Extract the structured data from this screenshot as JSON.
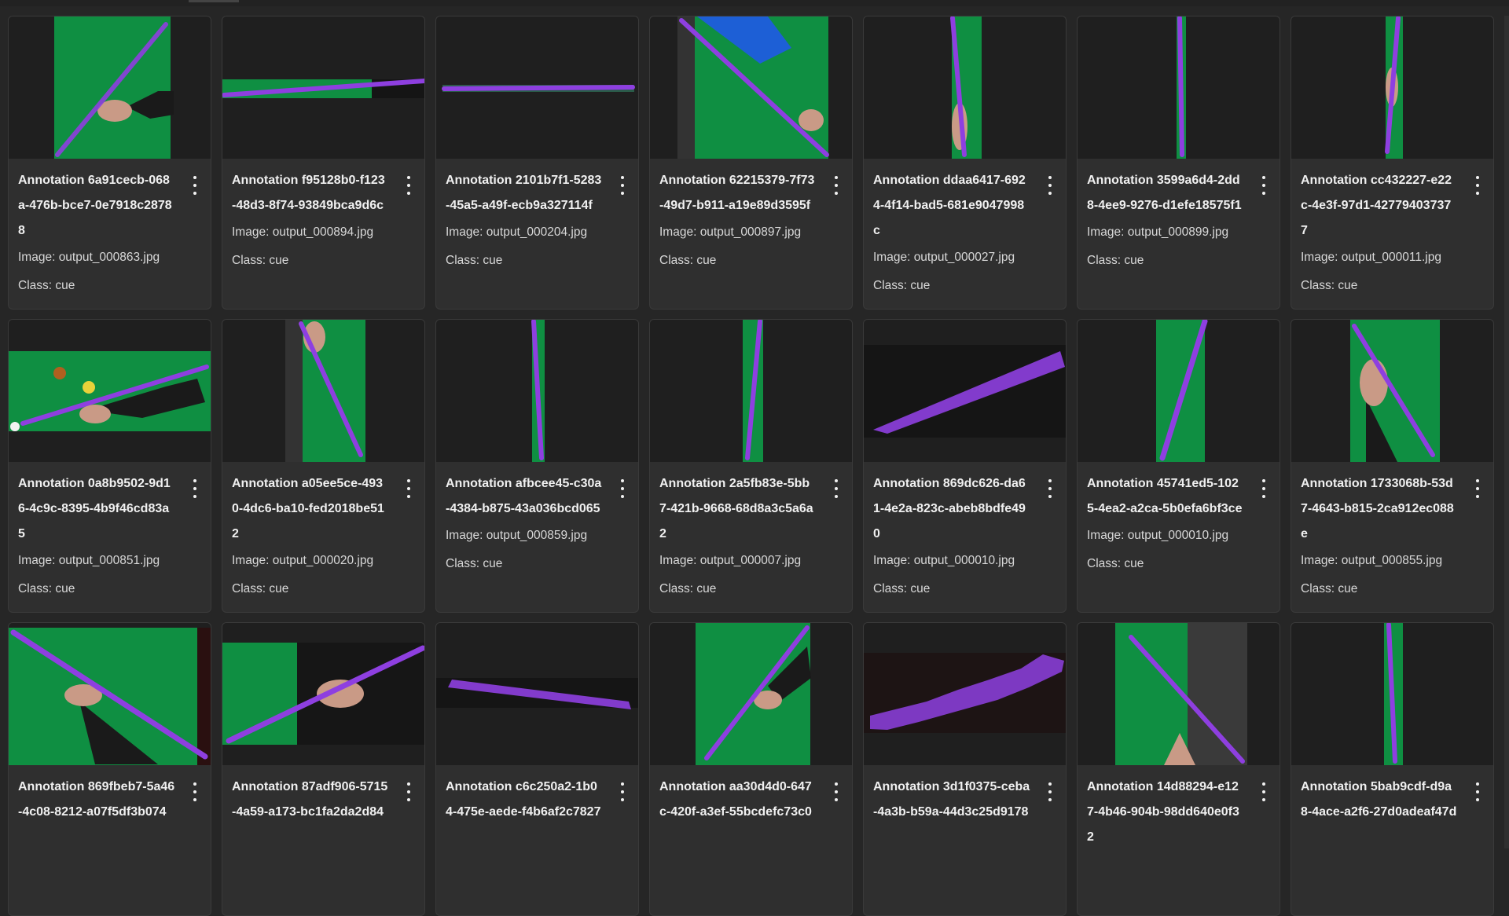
{
  "colors": {
    "background": "#262626",
    "card": "#2f2f2f",
    "felt": "#0f8f42",
    "mask": "#8e3fe0",
    "dark_frame": "#1f1f1f"
  },
  "cards": [
    {
      "title": "Annotation 6a91cecb-068a-476b-bce7-0e7918c28788",
      "image": "Image: output_000863.jpg",
      "class_label": "Class: cue"
    },
    {
      "title": "Annotation f95128b0-f123-48d3-8f74-93849bca9d6c",
      "image": "Image: output_000894.jpg",
      "class_label": "Class: cue"
    },
    {
      "title": "Annotation 2101b7f1-5283-45a5-a49f-ecb9a327114f",
      "image": "Image: output_000204.jpg",
      "class_label": "Class: cue"
    },
    {
      "title": "Annotation 62215379-7f73-49d7-b911-a19e89d3595f",
      "image": "Image: output_000897.jpg",
      "class_label": "Class: cue"
    },
    {
      "title": "Annotation ddaa6417-6924-4f14-bad5-681e9047998c",
      "image": "Image: output_000027.jpg",
      "class_label": "Class: cue"
    },
    {
      "title": "Annotation 3599a6d4-2dd8-4ee9-9276-d1efe18575f1",
      "image": "Image: output_000899.jpg",
      "class_label": "Class: cue"
    },
    {
      "title": "Annotation cc432227-e22c-4e3f-97d1-427794037377",
      "image": "Image: output_000011.jpg",
      "class_label": "Class: cue"
    },
    {
      "title": "Annotation 0a8b9502-9d16-4c9c-8395-4b9f46cd83a5",
      "image": "Image: output_000851.jpg",
      "class_label": "Class: cue"
    },
    {
      "title": "Annotation a05ee5ce-4930-4dc6-ba10-fed2018be512",
      "image": "Image: output_000020.jpg",
      "class_label": "Class: cue"
    },
    {
      "title": "Annotation afbcee45-c30a-4384-b875-43a036bcd065",
      "image": "Image: output_000859.jpg",
      "class_label": "Class: cue"
    },
    {
      "title": "Annotation 2a5fb83e-5bb7-421b-9668-68d8a3c5a6a2",
      "image": "Image: output_000007.jpg",
      "class_label": "Class: cue"
    },
    {
      "title": "Annotation 869dc626-da61-4e2a-823c-abeb8bdfe490",
      "image": "Image: output_000010.jpg",
      "class_label": "Class: cue"
    },
    {
      "title": "Annotation 45741ed5-1025-4ea2-a2ca-5b0efa6bf3ce",
      "image": "Image: output_000010.jpg",
      "class_label": "Class: cue"
    },
    {
      "title": "Annotation 1733068b-53d7-4643-b815-2ca912ec088e",
      "image": "Image: output_000855.jpg",
      "class_label": "Class: cue"
    },
    {
      "title": "Annotation 869fbeb7-5a46-4c08-8212-a07f5df3b074",
      "image": "",
      "class_label": ""
    },
    {
      "title": "Annotation 87adf906-5715-4a59-a173-bc1fa2da2d84",
      "image": "",
      "class_label": ""
    },
    {
      "title": "Annotation c6c250a2-1b04-475e-aede-f4b6af2c7827",
      "image": "",
      "class_label": ""
    },
    {
      "title": "Annotation aa30d4d0-647c-420f-a3ef-55bcdefc73c0",
      "image": "",
      "class_label": ""
    },
    {
      "title": "Annotation 3d1f0375-ceba-4a3b-b59a-44d3c25d9178",
      "image": "",
      "class_label": ""
    },
    {
      "title": "Annotation 14d88294-e127-4b46-904b-98dd640e0f32",
      "image": "",
      "class_label": ""
    },
    {
      "title": "Annotation 5bab9cdf-d9a8-4ace-a2f6-27d0adeaf47d",
      "image": "",
      "class_label": ""
    }
  ]
}
